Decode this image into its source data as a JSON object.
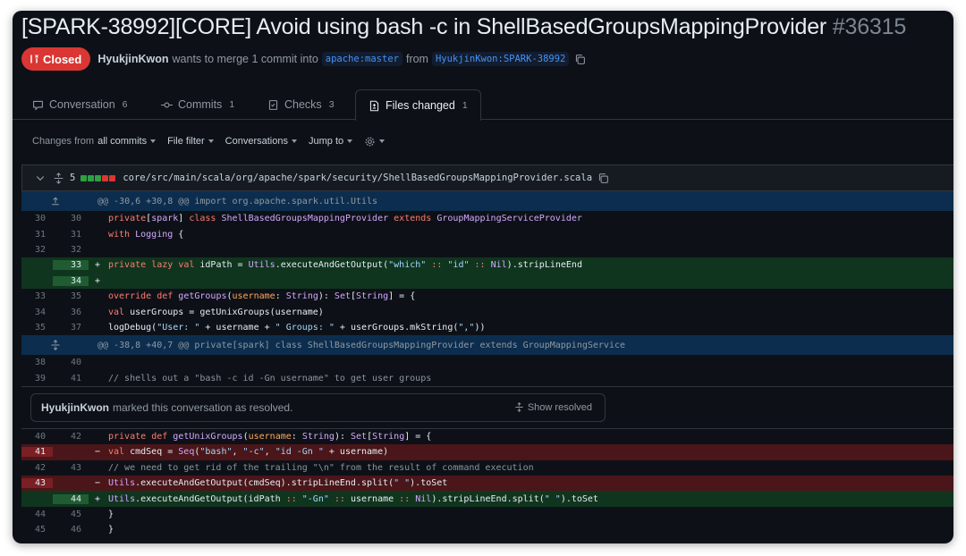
{
  "pr": {
    "title": "[SPARK-38992][CORE] Avoid using bash -c in ShellBasedGroupsMappingProvider",
    "number": "#36315",
    "status": "Closed",
    "author": "HyukjinKwon",
    "merge_text": "wants to merge 1 commit into",
    "base_branch": "apache:master",
    "from_text": "from",
    "head_branch": "HyukjinKwon:SPARK-38992"
  },
  "tabs": [
    {
      "label": "Conversation",
      "count": "6",
      "icon": "comment-icon"
    },
    {
      "label": "Commits",
      "count": "1",
      "icon": "commit-icon"
    },
    {
      "label": "Checks",
      "count": "3",
      "icon": "checklist-icon"
    },
    {
      "label": "Files changed",
      "count": "1",
      "icon": "file-diff-icon"
    }
  ],
  "toolbar": {
    "changes_prefix": "Changes from",
    "changes_value": "all commits",
    "file_filter": "File filter",
    "conversations": "Conversations",
    "jump_to": "Jump to"
  },
  "file": {
    "changes": "5",
    "path": "core/src/main/scala/org/apache/spark/security/ShellBasedGroupsMappingProvider.scala",
    "diffstat_colors": [
      "#2ea043",
      "#2ea043",
      "#2ea043",
      "#da3633",
      "#da3633"
    ]
  },
  "diff": {
    "hunk1": "@@ -30,6 +30,8 @@ import org.apache.spark.util.Utils",
    "hunk2": "@@ -38,8 +40,7 @@ private[spark] class ShellBasedGroupsMappingProvider extends GroupMappingService",
    "lines": {
      "l30": {
        "old": "30",
        "new": "30"
      },
      "l31": {
        "old": "31",
        "new": "31"
      },
      "l32": {
        "old": "32",
        "new": "32"
      },
      "l33a": {
        "old": "",
        "new": "33",
        "sign": "+"
      },
      "l34a": {
        "old": "",
        "new": "34",
        "sign": "+"
      },
      "l35": {
        "old": "33",
        "new": "35"
      },
      "l36": {
        "old": "34",
        "new": "36"
      },
      "l37": {
        "old": "35",
        "new": "37"
      },
      "l40": {
        "old": "38",
        "new": "40"
      },
      "l41": {
        "old": "39",
        "new": "41"
      },
      "l42": {
        "old": "40",
        "new": "42"
      },
      "l41d": {
        "old": "41",
        "new": "",
        "sign": "−"
      },
      "l43": {
        "old": "42",
        "new": "43"
      },
      "l43d": {
        "old": "43",
        "new": "",
        "sign": "−"
      },
      "l44a": {
        "old": "",
        "new": "44",
        "sign": "+"
      },
      "l45": {
        "old": "44",
        "new": "45"
      },
      "l46": {
        "old": "45",
        "new": "46"
      }
    }
  },
  "resolved": {
    "user": "HyukjinKwon",
    "text": "marked this conversation as resolved.",
    "show": "Show resolved"
  },
  "colors": {
    "background": "#0d1117",
    "closed_badge": "#da3633",
    "addition_bg": "#10351e",
    "deletion_bg": "#4a1619",
    "hunk_bg": "#0c2d4e",
    "link": "#4493f8"
  }
}
